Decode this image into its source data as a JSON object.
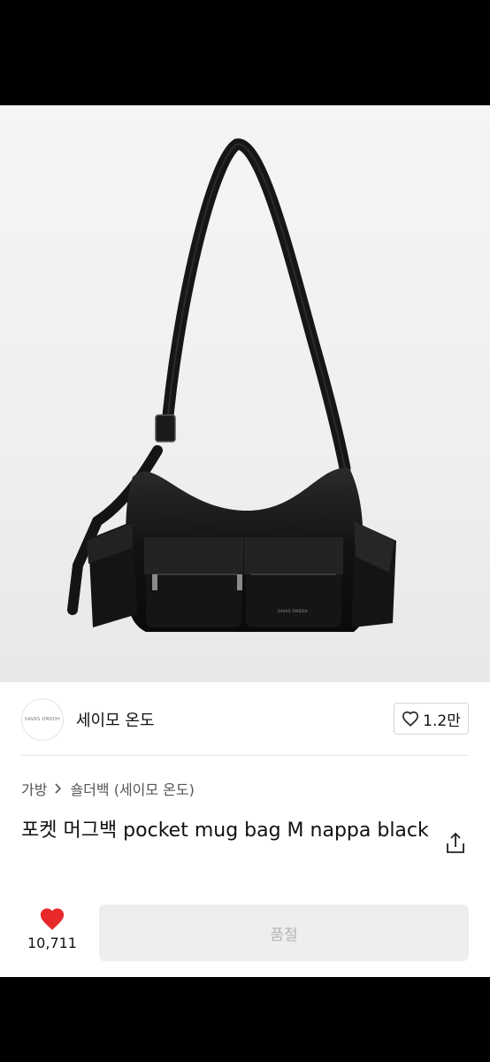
{
  "seller": {
    "avatar_text": "SAVAS ONDOH",
    "name": "세이모 온도",
    "like_count": "1.2만"
  },
  "breadcrumb": {
    "category": "가방",
    "subcategory": "숄더백 (세이모 온도)"
  },
  "product": {
    "title": "포켓 머그백 pocket mug bag M nappa black",
    "bag_logo_text": "SAVAS ONDOH"
  },
  "action_bar": {
    "wish_count": "10,711",
    "soldout_label": "품절"
  },
  "colors": {
    "heart": "#e8292b",
    "soldout_bg": "#eeeeee"
  },
  "icons": {
    "like": "heart-outline-icon",
    "share": "share-icon",
    "wish": "heart-filled-icon",
    "breadcrumb_separator": "chevron-right-icon"
  }
}
